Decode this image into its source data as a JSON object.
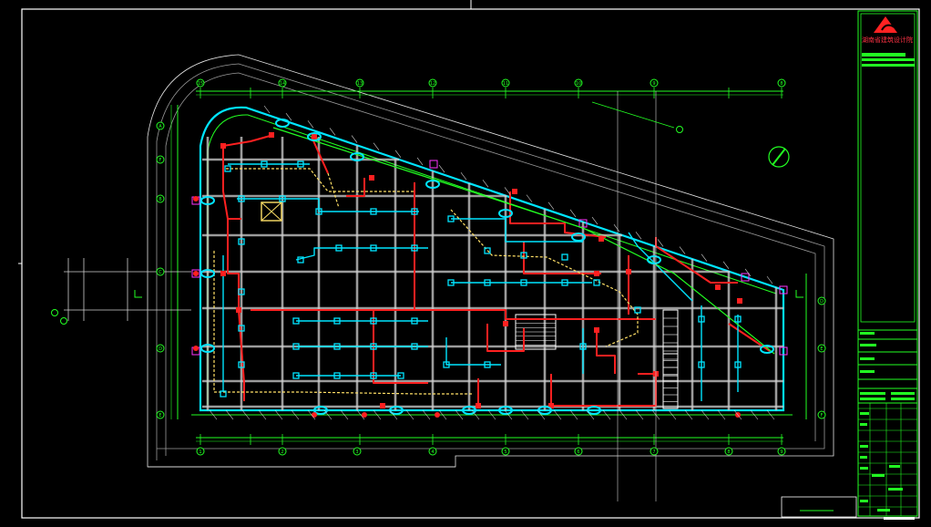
{
  "drawing": {
    "type": "cad-floor-plan",
    "background": "#000000",
    "colors": {
      "frame": "#ffffff",
      "axis": "#22ff22",
      "grid": "#cfcfcf",
      "duct_supply": "#ff2020",
      "duct_return": "#00e5ff",
      "duct_exhaust": "#ffe066",
      "outline": "#e6e6e6",
      "magenta": "#ff33ff",
      "logo": "#ff2222"
    },
    "axis_labels_top": [
      "15",
      "14",
      "13",
      "12",
      "11",
      "10",
      "9",
      "8"
    ],
    "axis_labels_bottom": [
      "1",
      "2",
      "3",
      "4",
      "5",
      "6",
      "7",
      "8",
      "9"
    ],
    "axis_labels_left": [
      "A",
      "B",
      "C",
      "D",
      "E",
      "F"
    ],
    "axis_labels_right": [
      "F",
      "E",
      "D"
    ]
  },
  "title_block": {
    "company": "湖南省建筑设计院",
    "logo_icon": "triangle-logo-icon"
  },
  "north_arrow_icon": "north-arrow-icon"
}
